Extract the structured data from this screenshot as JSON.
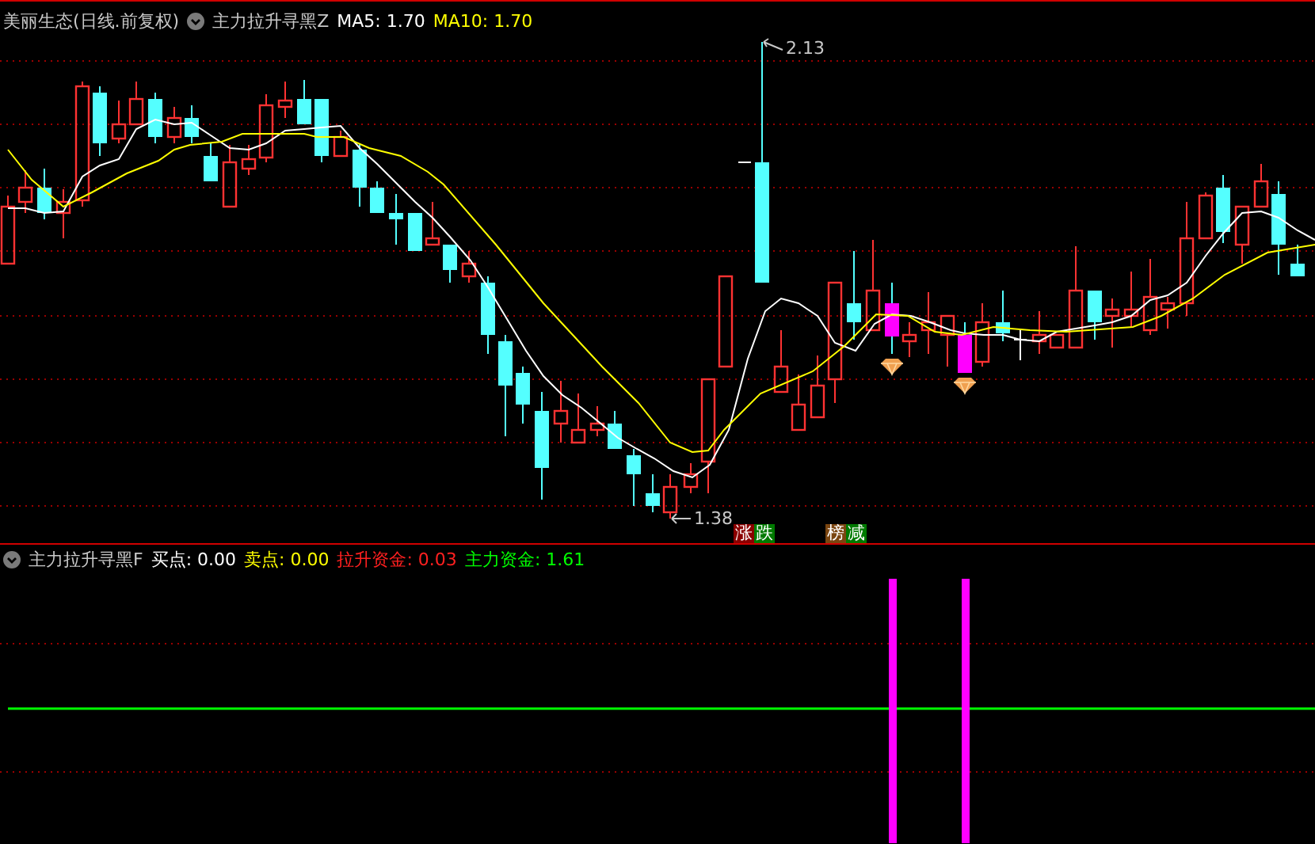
{
  "main_panel": {
    "title": "美丽生态(日线.前复权)",
    "indicator": "主力拉升寻黑Z",
    "legend": [
      {
        "label": "MA5: 1.70",
        "color": "#ffffff"
      },
      {
        "label": "MA10: 1.70",
        "color": "#ffff00"
      }
    ],
    "high_label": "2.13",
    "low_label": "1.38",
    "signal_tags": [
      {
        "parts": [
          {
            "text": "涨",
            "color": "#8b0000"
          },
          {
            "text": "跌",
            "color": "#007a00"
          }
        ]
      },
      {
        "parts": [
          {
            "text": "榜",
            "color": "#7a4510"
          },
          {
            "text": "减",
            "color": "#007a00"
          }
        ]
      }
    ]
  },
  "sub_panel": {
    "indicator": "主力拉升寻黑F",
    "legend": [
      {
        "label": "买点: 0.00",
        "color": "#ffffff"
      },
      {
        "label": "卖点: 0.00",
        "color": "#ffff00"
      },
      {
        "label": "拉升资金: 0.03",
        "color": "#ff2020"
      },
      {
        "label": "主力资金: 1.61",
        "color": "#00ff00"
      }
    ]
  }
}
